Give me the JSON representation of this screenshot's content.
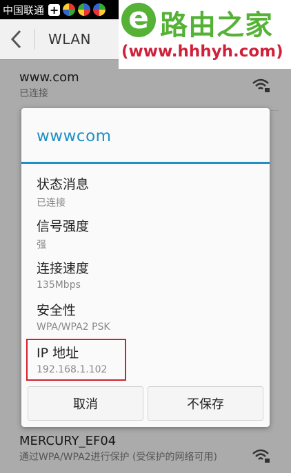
{
  "status_bar": {
    "carrier": "中国联通"
  },
  "watermark": {
    "brand": "路由之家",
    "url": "(www.hhhyh.com)"
  },
  "action_bar": {
    "title": "WLAN"
  },
  "networks": [
    {
      "name": "www.com",
      "status": "已连接"
    },
    {
      "name": "MERCURY_EF04",
      "status": "通过WPA/WPA2进行保护 (受保护的网络可用)"
    }
  ],
  "dialog": {
    "title": "wwwcom",
    "rows": [
      {
        "label": "状态消息",
        "value": "已连接"
      },
      {
        "label": "信号强度",
        "value": "强"
      },
      {
        "label": "连接速度",
        "value": "135Mbps"
      },
      {
        "label": "安全性",
        "value": "WPA/WPA2 PSK"
      },
      {
        "label": "IP 地址",
        "value": "192.168.1.102"
      }
    ],
    "cancel_label": "取消",
    "forget_label": "不保存"
  },
  "colors": {
    "accent": "#1e90c3",
    "highlight": "#d0212d",
    "logo_green": "#55b236",
    "logo_red": "#d0213a"
  },
  "icons": [
    "plus-icon",
    "back-chevron-icon",
    "wifi-locked-icon"
  ]
}
